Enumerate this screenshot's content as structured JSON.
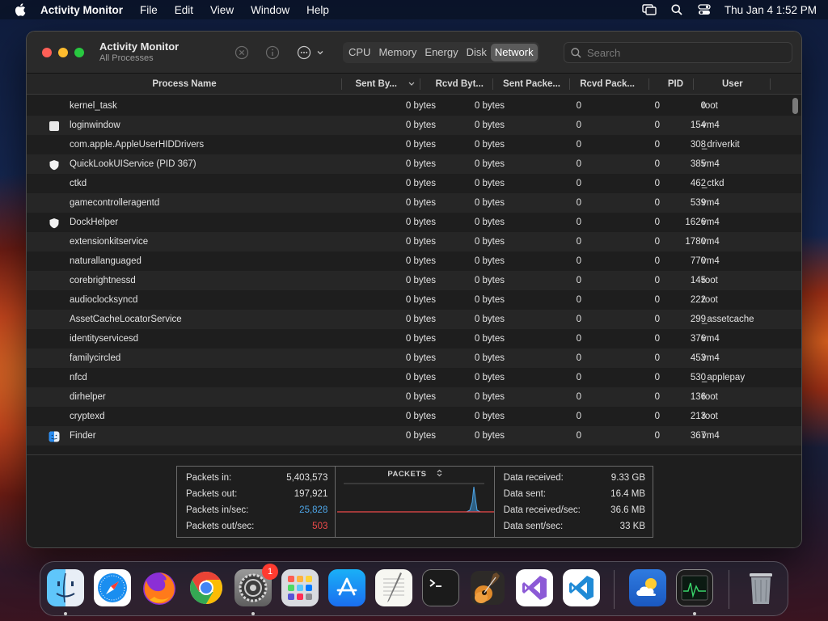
{
  "menubar": {
    "app_name": "Activity Monitor",
    "items": [
      "File",
      "Edit",
      "View",
      "Window",
      "Help"
    ],
    "clock": "Thu Jan 4  1:52 PM"
  },
  "window": {
    "title": "Activity Monitor",
    "subtitle": "All Processes",
    "tabs": [
      "CPU",
      "Memory",
      "Energy",
      "Disk",
      "Network"
    ],
    "active_tab": "Network",
    "search_placeholder": "Search"
  },
  "table": {
    "columns": [
      "Process Name",
      "Sent By...",
      "Rcvd Byt...",
      "Sent Packe...",
      "Rcvd Pack...",
      "PID",
      "User"
    ],
    "rows": [
      {
        "icon": "none",
        "name": "kernel_task",
        "sent_bytes": "0 bytes",
        "rcvd_bytes": "0 bytes",
        "sent_packets": "0",
        "rcvd_packets": "0",
        "pid": "0",
        "user": "root"
      },
      {
        "icon": "window-icon",
        "name": "loginwindow",
        "sent_bytes": "0 bytes",
        "rcvd_bytes": "0 bytes",
        "sent_packets": "0",
        "rcvd_packets": "0",
        "pid": "154",
        "user": "vm4"
      },
      {
        "icon": "none",
        "name": "com.apple.AppleUserHIDDrivers",
        "sent_bytes": "0 bytes",
        "rcvd_bytes": "0 bytes",
        "sent_packets": "0",
        "rcvd_packets": "0",
        "pid": "308",
        "user": "_driverkit"
      },
      {
        "icon": "shield-icon",
        "name": "QuickLookUIService (PID 367)",
        "sent_bytes": "0 bytes",
        "rcvd_bytes": "0 bytes",
        "sent_packets": "0",
        "rcvd_packets": "0",
        "pid": "385",
        "user": "vm4"
      },
      {
        "icon": "none",
        "name": "ctkd",
        "sent_bytes": "0 bytes",
        "rcvd_bytes": "0 bytes",
        "sent_packets": "0",
        "rcvd_packets": "0",
        "pid": "462",
        "user": "_ctkd"
      },
      {
        "icon": "none",
        "name": "gamecontrolleragentd",
        "sent_bytes": "0 bytes",
        "rcvd_bytes": "0 bytes",
        "sent_packets": "0",
        "rcvd_packets": "0",
        "pid": "539",
        "user": "vm4"
      },
      {
        "icon": "shield-icon",
        "name": "DockHelper",
        "sent_bytes": "0 bytes",
        "rcvd_bytes": "0 bytes",
        "sent_packets": "0",
        "rcvd_packets": "0",
        "pid": "1626",
        "user": "vm4"
      },
      {
        "icon": "none",
        "name": "extensionkitservice",
        "sent_bytes": "0 bytes",
        "rcvd_bytes": "0 bytes",
        "sent_packets": "0",
        "rcvd_packets": "0",
        "pid": "1780",
        "user": "vm4"
      },
      {
        "icon": "none",
        "name": "naturallanguaged",
        "sent_bytes": "0 bytes",
        "rcvd_bytes": "0 bytes",
        "sent_packets": "0",
        "rcvd_packets": "0",
        "pid": "770",
        "user": "vm4"
      },
      {
        "icon": "none",
        "name": "corebrightnessd",
        "sent_bytes": "0 bytes",
        "rcvd_bytes": "0 bytes",
        "sent_packets": "0",
        "rcvd_packets": "0",
        "pid": "145",
        "user": "root"
      },
      {
        "icon": "none",
        "name": "audioclocksyncd",
        "sent_bytes": "0 bytes",
        "rcvd_bytes": "0 bytes",
        "sent_packets": "0",
        "rcvd_packets": "0",
        "pid": "222",
        "user": "root"
      },
      {
        "icon": "none",
        "name": "AssetCacheLocatorService",
        "sent_bytes": "0 bytes",
        "rcvd_bytes": "0 bytes",
        "sent_packets": "0",
        "rcvd_packets": "0",
        "pid": "299",
        "user": "_assetcache"
      },
      {
        "icon": "none",
        "name": "identityservicesd",
        "sent_bytes": "0 bytes",
        "rcvd_bytes": "0 bytes",
        "sent_packets": "0",
        "rcvd_packets": "0",
        "pid": "376",
        "user": "vm4"
      },
      {
        "icon": "none",
        "name": "familycircled",
        "sent_bytes": "0 bytes",
        "rcvd_bytes": "0 bytes",
        "sent_packets": "0",
        "rcvd_packets": "0",
        "pid": "453",
        "user": "vm4"
      },
      {
        "icon": "none",
        "name": "nfcd",
        "sent_bytes": "0 bytes",
        "rcvd_bytes": "0 bytes",
        "sent_packets": "0",
        "rcvd_packets": "0",
        "pid": "530",
        "user": "_applepay"
      },
      {
        "icon": "none",
        "name": "dirhelper",
        "sent_bytes": "0 bytes",
        "rcvd_bytes": "0 bytes",
        "sent_packets": "0",
        "rcvd_packets": "0",
        "pid": "136",
        "user": "root"
      },
      {
        "icon": "none",
        "name": "cryptexd",
        "sent_bytes": "0 bytes",
        "rcvd_bytes": "0 bytes",
        "sent_packets": "0",
        "rcvd_packets": "0",
        "pid": "213",
        "user": "root"
      },
      {
        "icon": "finder-icon",
        "name": "Finder",
        "sent_bytes": "0 bytes",
        "rcvd_bytes": "0 bytes",
        "sent_packets": "0",
        "rcvd_packets": "0",
        "pid": "367",
        "user": "vm4"
      }
    ]
  },
  "stats": {
    "left": [
      {
        "label": "Packets in:",
        "value": "5,403,573"
      },
      {
        "label": "Packets out:",
        "value": "197,921"
      },
      {
        "label": "Packets in/sec:",
        "value": "25,828"
      },
      {
        "label": "Packets out/sec:",
        "value": "503"
      }
    ],
    "graph_title": "PACKETS",
    "right": [
      {
        "label": "Data received:",
        "value": "9.33 GB"
      },
      {
        "label": "Data sent:",
        "value": "16.4 MB"
      },
      {
        "label": "Data received/sec:",
        "value": "36.6 MB"
      },
      {
        "label": "Data sent/sec:",
        "value": "33 KB"
      }
    ],
    "colors": {
      "in": "#4ea6e8",
      "out": "#ee4a4a"
    }
  },
  "dock": {
    "apps": [
      "Finder",
      "Safari",
      "Firefox",
      "Chrome",
      "System Settings",
      "Launchpad",
      "App Store",
      "TextEdit",
      "Terminal",
      "GarageBand",
      "Visual Studio",
      "VS Code",
      "Weather",
      "Activity Monitor",
      "Trash"
    ],
    "settings_badge": "1"
  }
}
